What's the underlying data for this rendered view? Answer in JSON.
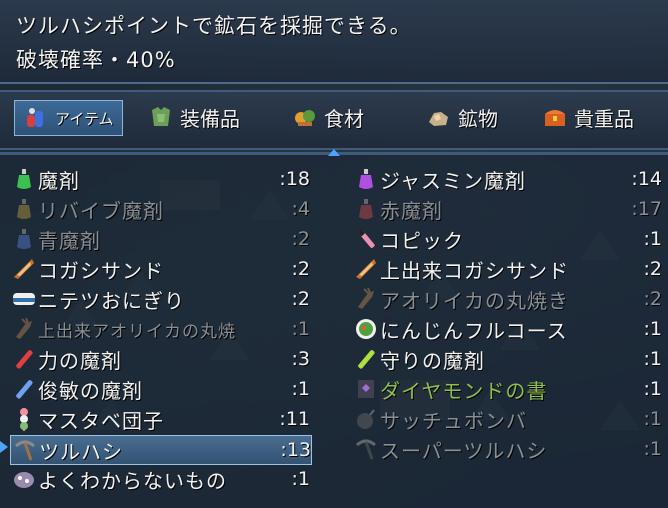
{
  "description": {
    "line1": "ツルハシポイントで鉱石を採掘できる。",
    "line2": "破壊確率・40%"
  },
  "tabs": [
    {
      "label": "アイテム",
      "icon": "potion-bag-icon",
      "active": true
    },
    {
      "label": "装備品",
      "icon": "armor-icon",
      "active": false
    },
    {
      "label": "食材",
      "icon": "food-icon",
      "active": false
    },
    {
      "label": "鉱物",
      "icon": "ore-icon",
      "active": false
    },
    {
      "label": "貴重品",
      "icon": "treasure-chest-icon",
      "active": false
    }
  ],
  "items_left": [
    {
      "name": "魔剤",
      "count": ":18",
      "icon": "green-potion-icon",
      "state": "normal"
    },
    {
      "name": "リバイブ魔剤",
      "count": ":4",
      "icon": "gold-potion-icon",
      "state": "dim"
    },
    {
      "name": "青魔剤",
      "count": ":2",
      "icon": "blue-potion-icon",
      "state": "dim"
    },
    {
      "name": "コガシサンド",
      "count": ":2",
      "icon": "sandwich-icon",
      "state": "normal"
    },
    {
      "name": "ニテツおにぎり",
      "count": ":2",
      "icon": "riceball-icon",
      "state": "normal"
    },
    {
      "name": "上出来アオリイカの丸焼",
      "count": ":1",
      "icon": "grilled-squid-icon",
      "state": "dim"
    },
    {
      "name": "力の魔剤",
      "count": ":3",
      "icon": "red-vial-icon",
      "state": "normal"
    },
    {
      "name": "俊敏の魔剤",
      "count": ":1",
      "icon": "blue-vial-icon",
      "state": "normal"
    },
    {
      "name": "マスタベ団子",
      "count": ":11",
      "icon": "dango-icon",
      "state": "normal"
    },
    {
      "name": "ツルハシ",
      "count": ":13",
      "icon": "pickaxe-icon",
      "state": "selected"
    },
    {
      "name": "よくわからないもの",
      "count": ":1",
      "icon": "mystery-blob-icon",
      "state": "normal"
    }
  ],
  "items_right": [
    {
      "name": "ジャスミン魔剤",
      "count": ":14",
      "icon": "purple-potion-icon",
      "state": "normal"
    },
    {
      "name": "赤魔剤",
      "count": ":17",
      "icon": "red-potion-icon",
      "state": "dim"
    },
    {
      "name": "コピック",
      "count": ":1",
      "icon": "marker-icon",
      "state": "normal"
    },
    {
      "name": "上出来コガシサンド",
      "count": ":2",
      "icon": "sandwich-icon",
      "state": "normal"
    },
    {
      "name": "アオリイカの丸焼き",
      "count": ":2",
      "icon": "grilled-squid-icon",
      "state": "dim"
    },
    {
      "name": "にんじんフルコース",
      "count": ":1",
      "icon": "salad-bowl-icon",
      "state": "normal"
    },
    {
      "name": "守りの魔剤",
      "count": ":1",
      "icon": "green-vial-icon",
      "state": "normal"
    },
    {
      "name": "ダイヤモンドの書",
      "count": ":1",
      "icon": "book-icon",
      "state": "green"
    },
    {
      "name": "サッチュボンバ",
      "count": ":1",
      "icon": "bomb-icon",
      "state": "dim"
    },
    {
      "name": "スーパーツルハシ",
      "count": ":1",
      "icon": "super-pickaxe-icon",
      "state": "dim"
    }
  ],
  "colors": {
    "selected_bg": "#3d6a96",
    "accent": "#4fa3ff",
    "dim_text": "#8a8f96",
    "green_text": "#8fbf4f"
  }
}
